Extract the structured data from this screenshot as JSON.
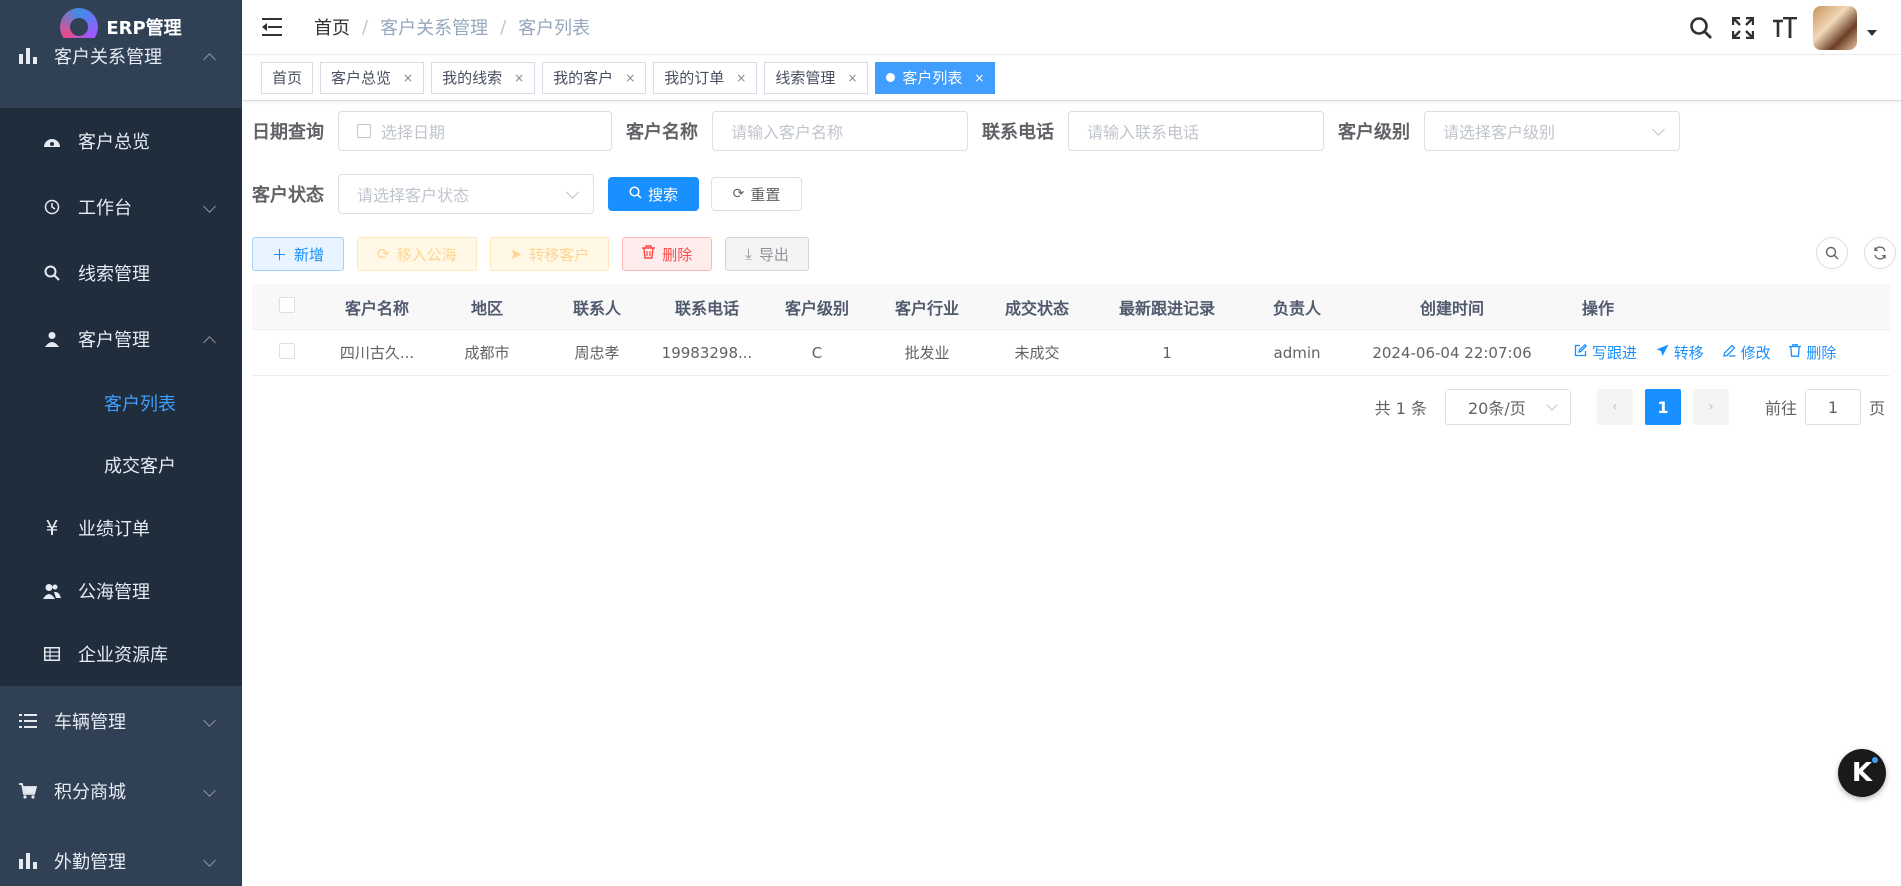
{
  "app": {
    "title": "ERP管理"
  },
  "sidebar": {
    "items": [
      {
        "label": "客户关系管理",
        "icon": "bar-chart-icon"
      },
      {
        "label": "客户总览",
        "icon": "dashboard-icon"
      },
      {
        "label": "工作台",
        "icon": "history-icon"
      },
      {
        "label": "线索管理",
        "icon": "search-icon"
      },
      {
        "label": "客户管理",
        "icon": "user-icon"
      },
      {
        "label": "客户列表"
      },
      {
        "label": "成交客户"
      },
      {
        "label": "业绩订单",
        "icon": "yen-icon"
      },
      {
        "label": "公海管理",
        "icon": "peoples-icon"
      },
      {
        "label": "企业资源库",
        "icon": "table-icon"
      },
      {
        "label": "车辆管理",
        "icon": "list-icon"
      },
      {
        "label": "积分商城",
        "icon": "cart-icon"
      },
      {
        "label": "外勤管理",
        "icon": "bar-chart-icon"
      }
    ]
  },
  "breadcrumb": [
    "首页",
    "客户关系管理",
    "客户列表"
  ],
  "tags": [
    {
      "label": "首页"
    },
    {
      "label": "客户总览"
    },
    {
      "label": "我的线索"
    },
    {
      "label": "我的客户"
    },
    {
      "label": "我的订单"
    },
    {
      "label": "线索管理"
    },
    {
      "label": "客户列表"
    }
  ],
  "search": {
    "date_label": "日期查询",
    "date_placeholder": "选择日期",
    "name_label": "客户名称",
    "name_placeholder": "请输入客户名称",
    "phone_label": "联系电话",
    "phone_placeholder": "请输入联系电话",
    "level_label": "客户级别",
    "level_placeholder": "请选择客户级别",
    "status_label": "客户状态",
    "status_placeholder": "请选择客户状态",
    "search_btn": "搜索",
    "reset_btn": "重置"
  },
  "toolbar": {
    "add": "新增",
    "move_pool": "移入公海",
    "transfer": "转移客户",
    "delete": "删除",
    "export": "导出"
  },
  "table": {
    "columns": [
      "客户名称",
      "地区",
      "联系人",
      "联系电话",
      "客户级别",
      "客户行业",
      "成交状态",
      "最新跟进记录",
      "负责人",
      "创建时间",
      "操作"
    ],
    "rows": [
      {
        "name": "四川古久...",
        "region": "成都市",
        "contact": "周忠孝",
        "phone": "19983298...",
        "level": "C",
        "industry": "批发业",
        "deal_status": "未成交",
        "latest_follow": "1",
        "owner": "admin",
        "created": "2024-06-04 22:07:06"
      }
    ],
    "actions": [
      "写跟进",
      "转移",
      "修改",
      "删除"
    ]
  },
  "pagination": {
    "total_text": "共 1 条",
    "page_size": "20条/页",
    "current_page": "1",
    "goto_label": "前往",
    "goto_value": "1",
    "page_suffix": "页"
  },
  "colors": {
    "sidebar_bg": "#304156",
    "submenu_bg": "#1f2d3d",
    "primary": "#1890ff",
    "active_menu": "#409eff"
  }
}
